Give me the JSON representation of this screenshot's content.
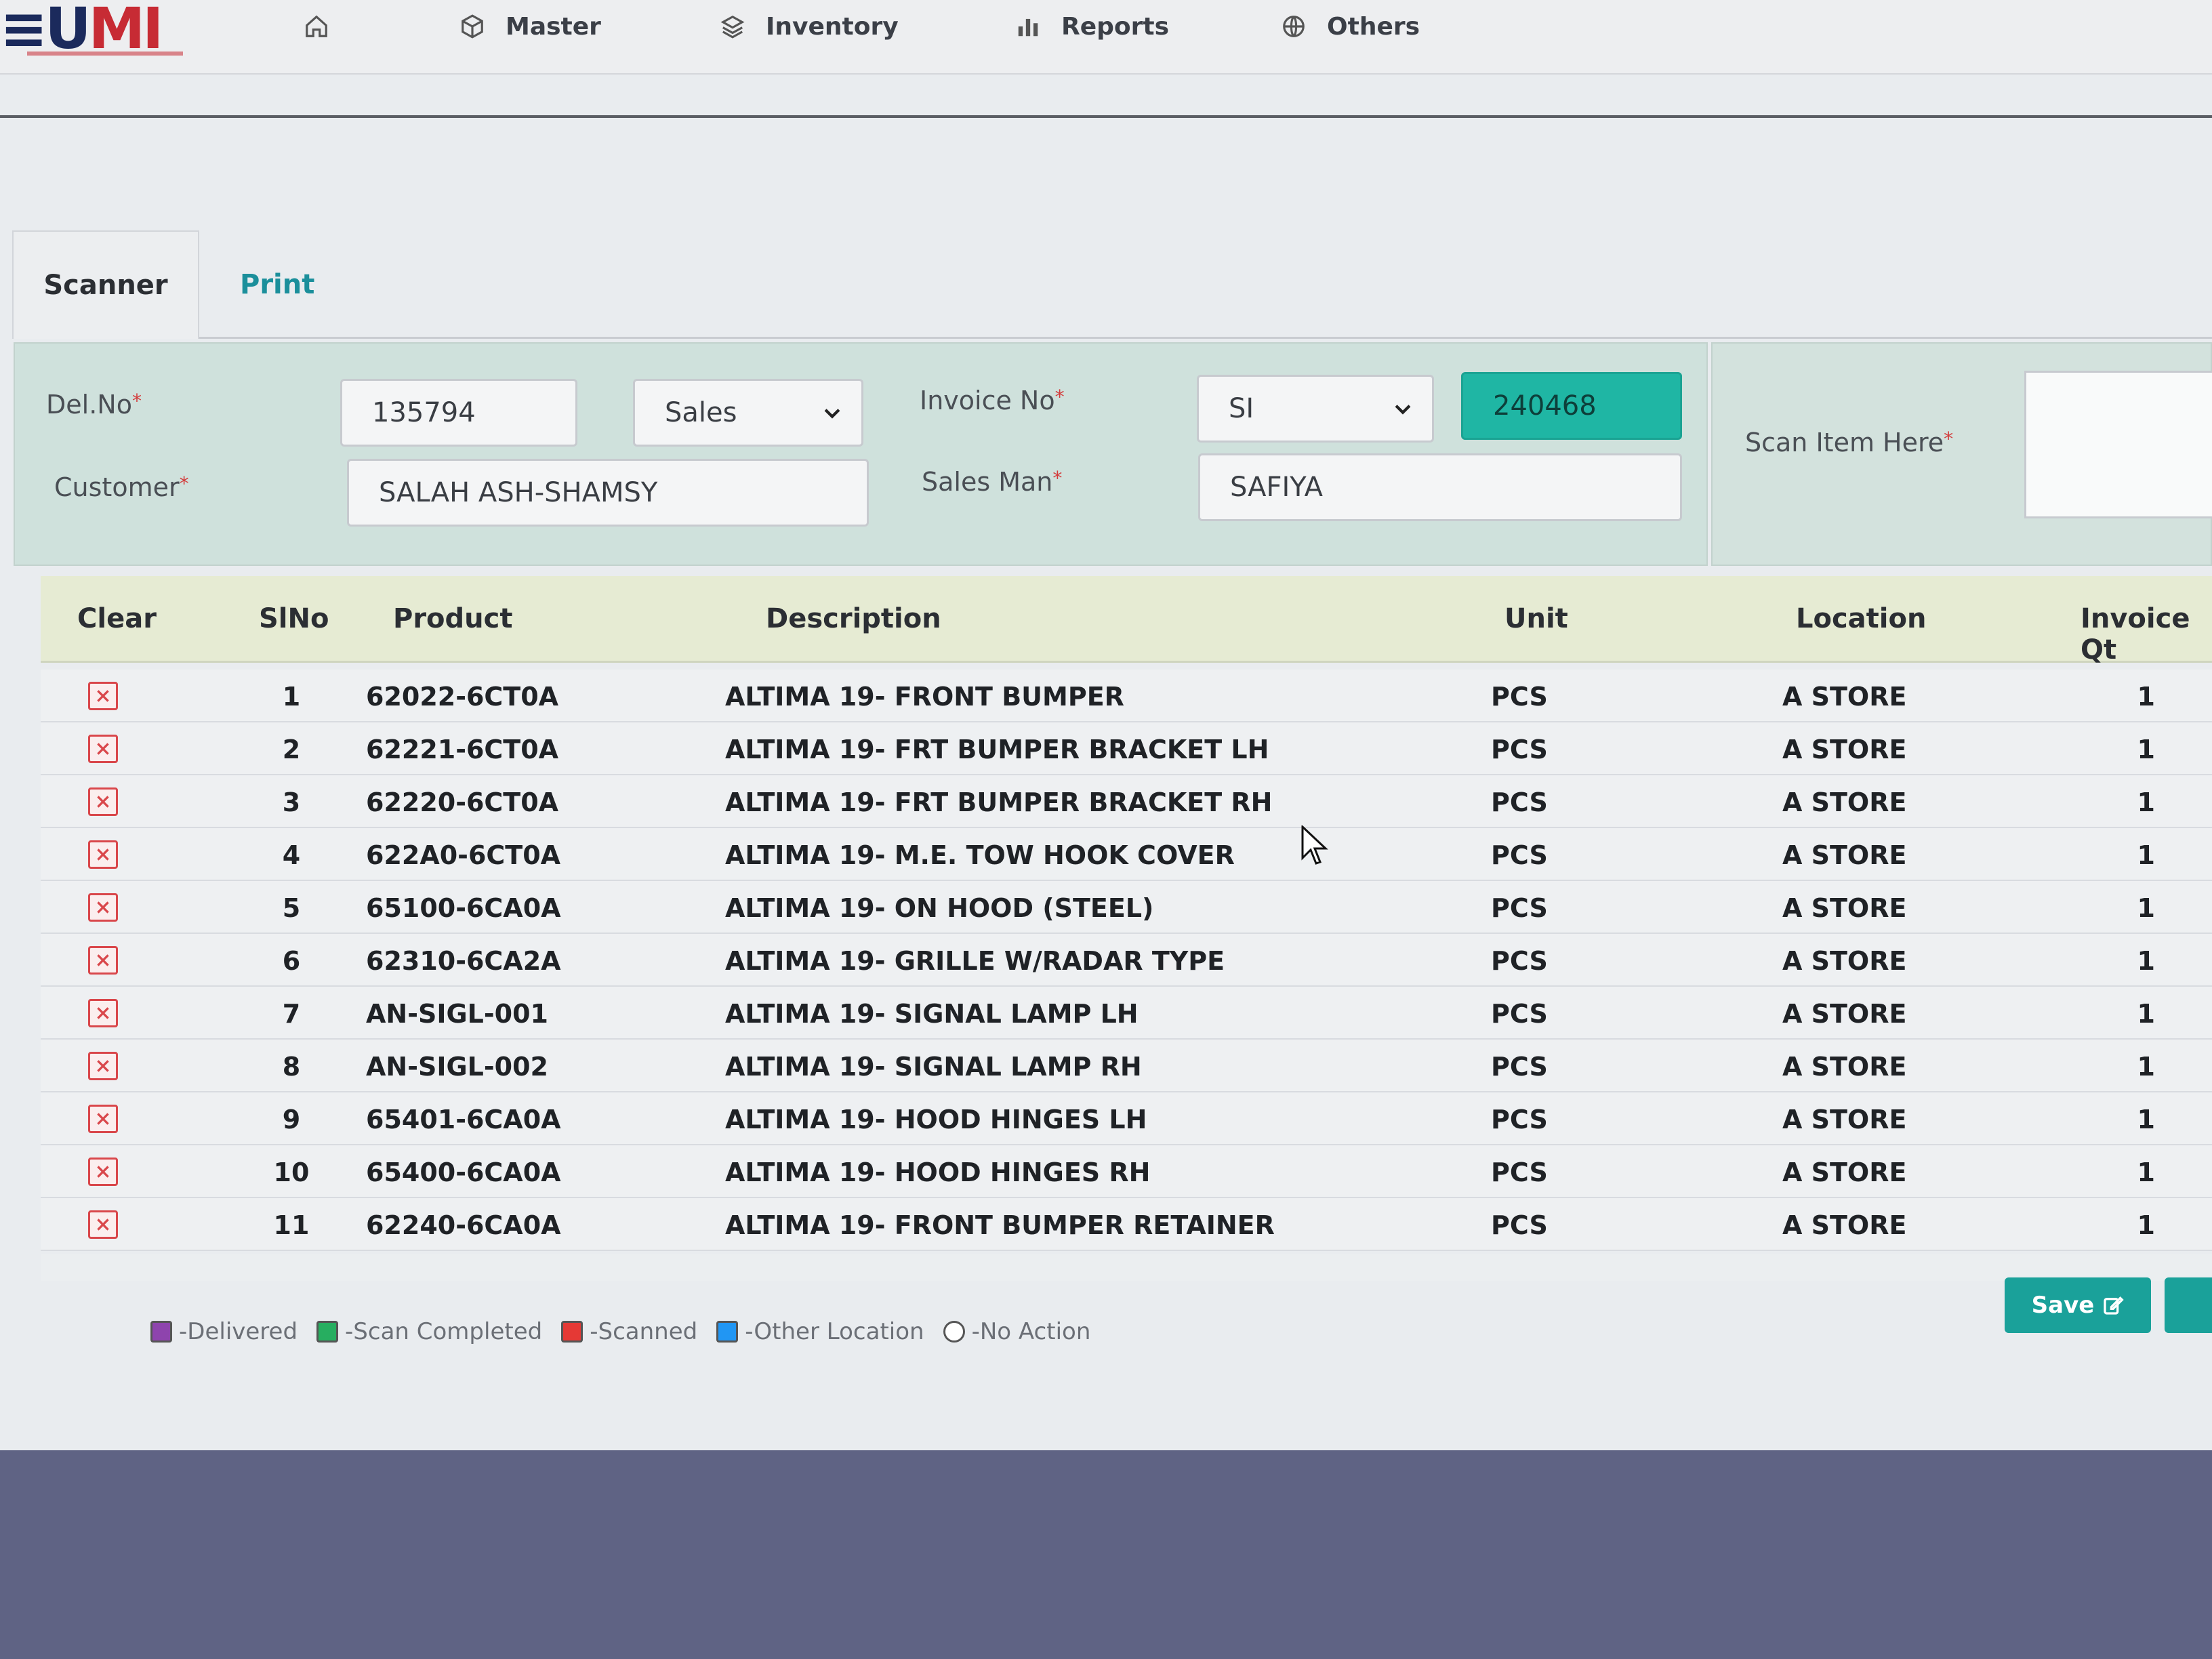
{
  "app": {
    "logo_text": "EUMI"
  },
  "nav": {
    "items": [
      {
        "label": "",
        "icon": "home-icon"
      },
      {
        "label": "Master",
        "icon": "cube-icon"
      },
      {
        "label": "Inventory",
        "icon": "layers-icon"
      },
      {
        "label": "Reports",
        "icon": "bar-chart-icon"
      },
      {
        "label": "Others",
        "icon": "globe-icon"
      }
    ]
  },
  "tabs": {
    "scanner": "Scanner",
    "print": "Print"
  },
  "form": {
    "del_no_label": "Del.No",
    "del_no_value": "135794",
    "type_value": "Sales",
    "customer_label": "Customer",
    "customer_value": "SALAH ASH-SHAMSY",
    "invoice_no_label": "Invoice No",
    "invoice_prefix": "SI",
    "invoice_number": "240468",
    "sales_man_label": "Sales Man",
    "sales_man_value": "SAFIYA",
    "scan_item_label": "Scan Item Here",
    "scan_item_value": ""
  },
  "table": {
    "headers": {
      "clear": "Clear",
      "slno": "SlNo",
      "product": "Product",
      "description": "Description",
      "unit": "Unit",
      "location": "Location",
      "invoice_qty": "Invoice Qt"
    },
    "rows": [
      {
        "slno": "1",
        "product": "62022-6CT0A",
        "description": "ALTIMA 19- FRONT BUMPER",
        "unit": "PCS",
        "location": "A STORE",
        "qty": "1"
      },
      {
        "slno": "2",
        "product": "62221-6CT0A",
        "description": "ALTIMA 19- FRT BUMPER BRACKET LH",
        "unit": "PCS",
        "location": "A STORE",
        "qty": "1"
      },
      {
        "slno": "3",
        "product": "62220-6CT0A",
        "description": "ALTIMA 19- FRT BUMPER BRACKET RH",
        "unit": "PCS",
        "location": "A STORE",
        "qty": "1"
      },
      {
        "slno": "4",
        "product": "622A0-6CT0A",
        "description": "ALTIMA 19- M.E. TOW HOOK COVER",
        "unit": "PCS",
        "location": "A STORE",
        "qty": "1"
      },
      {
        "slno": "5",
        "product": "65100-6CA0A",
        "description": "ALTIMA 19- ON HOOD (STEEL)",
        "unit": "PCS",
        "location": "A STORE",
        "qty": "1"
      },
      {
        "slno": "6",
        "product": "62310-6CA2A",
        "description": "ALTIMA 19- GRILLE W/RADAR TYPE",
        "unit": "PCS",
        "location": "A STORE",
        "qty": "1"
      },
      {
        "slno": "7",
        "product": "AN-SIGL-001",
        "description": "ALTIMA 19- SIGNAL LAMP LH",
        "unit": "PCS",
        "location": "A STORE",
        "qty": "1"
      },
      {
        "slno": "8",
        "product": "AN-SIGL-002",
        "description": "ALTIMA 19- SIGNAL LAMP RH",
        "unit": "PCS",
        "location": "A STORE",
        "qty": "1"
      },
      {
        "slno": "9",
        "product": "65401-6CA0A",
        "description": "ALTIMA 19- HOOD HINGES LH",
        "unit": "PCS",
        "location": "A STORE",
        "qty": "1"
      },
      {
        "slno": "10",
        "product": "65400-6CA0A",
        "description": "ALTIMA 19- HOOD HINGES RH",
        "unit": "PCS",
        "location": "A STORE",
        "qty": "1"
      },
      {
        "slno": "11",
        "product": "62240-6CA0A",
        "description": "ALTIMA 19- FRONT BUMPER RETAINER",
        "unit": "PCS",
        "location": "A STORE",
        "qty": "1"
      }
    ]
  },
  "legend": [
    {
      "label": "-Delivered",
      "color": "#8e44ad"
    },
    {
      "label": "-Scan Completed",
      "color": "#27ae60"
    },
    {
      "label": "-Scanned",
      "color": "#e53935"
    },
    {
      "label": "-Other Location",
      "color": "#2196f3"
    },
    {
      "label": "-No Action",
      "color": "#ffffff"
    }
  ],
  "actions": {
    "save_label": "Save"
  },
  "colors": {
    "accent": "#1aa19a",
    "panel": "#cfe1dc",
    "header": "#e6ebd3",
    "danger": "#d9474b"
  }
}
